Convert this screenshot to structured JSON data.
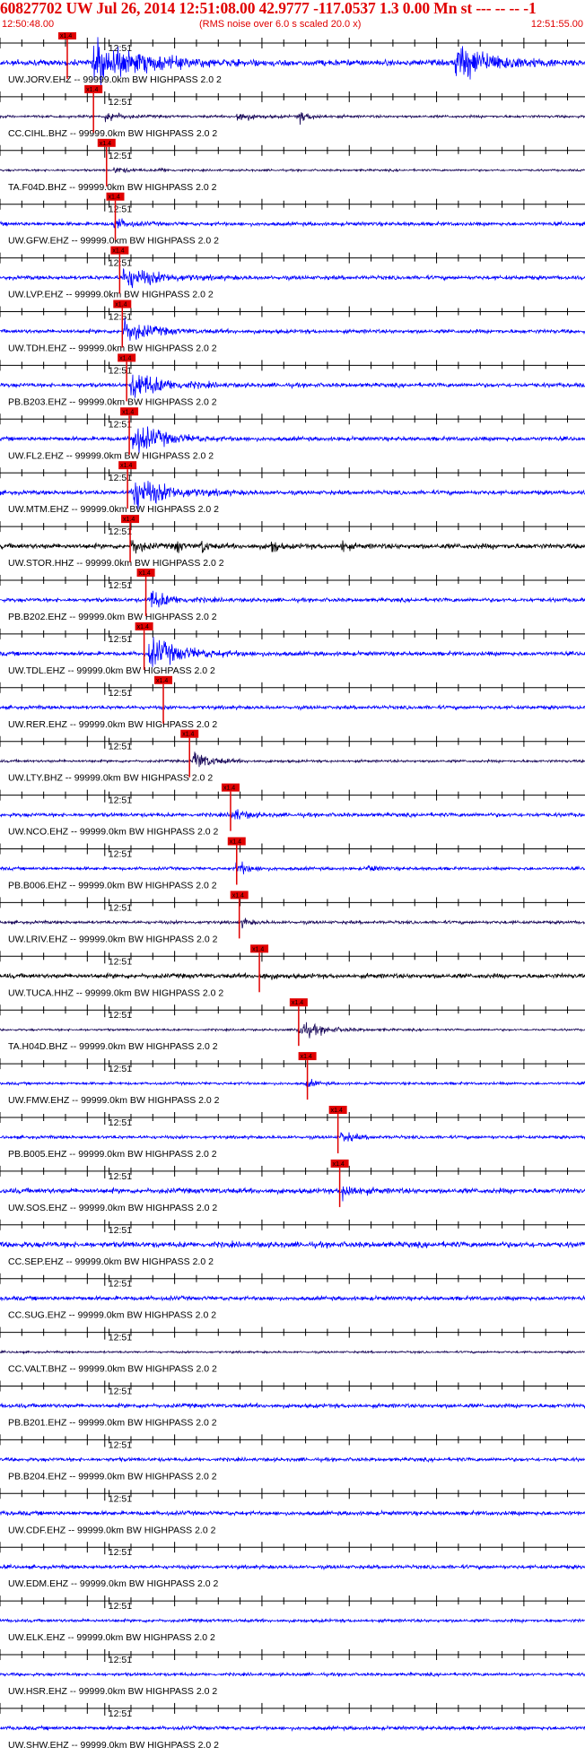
{
  "header": {
    "title": "60827702 UW Jul 26, 2014 12:51:08.00   42.9777 -117.0537  1.3 0.00 Mn st --- -- --  -1",
    "start_time": "12:50:48.00",
    "note": "(RMS noise over 6.0 s scaled 20.0 x)",
    "end_time": "12:51:55.00"
  },
  "colors": {
    "header_text": "#e00000",
    "trace_blue": "#0000ff",
    "trace_dark": "#1a0a5a",
    "trace_black": "#000000",
    "pick": "#e00000",
    "axis": "#000000"
  },
  "chart_data": {
    "type": "line",
    "x_unit": "time",
    "xlim": [
      "12:50:48.00",
      "12:51:55.00"
    ],
    "minute_label": "12:51",
    "pick_label": "x1.4",
    "label_suffix": " -- 99999.0km BW  HIGHPASS  2.0  2",
    "traces": [
      {
        "station": "UW.JORV.EHZ",
        "color": "blue",
        "pick": "12:50:55.5",
        "events": [
          {
            "t": "12:50:58.5",
            "amp": 1.6,
            "dur": 12
          },
          {
            "t": "12:51:40.0",
            "amp": 1.6,
            "dur": 9
          }
        ],
        "noise": 0.22
      },
      {
        "station": "CC.CIHL.BHZ",
        "color": "dark",
        "pick": "12:50:58.5",
        "events": [
          {
            "t": "12:51:00.0",
            "amp": 0.6,
            "dur": 3
          },
          {
            "t": "12:51:15.0",
            "amp": 0.55,
            "dur": 3
          },
          {
            "t": "12:51:22.0",
            "amp": 0.5,
            "dur": 3
          }
        ],
        "noise": 0.1
      },
      {
        "station": "TA.F04D.BHZ",
        "color": "dark",
        "pick": "12:51:00.0",
        "events": [
          {
            "t": "12:51:01.0",
            "amp": 0.3,
            "dur": 3
          },
          {
            "t": "12:51:06.0",
            "amp": 0.25,
            "dur": 2
          }
        ],
        "noise": 0.08
      },
      {
        "station": "UW.GFW.EHZ",
        "color": "blue",
        "pick": "12:51:01.0",
        "events": [
          {
            "t": "12:51:01.0",
            "amp": 0.55,
            "dur": 3
          }
        ],
        "noise": 0.14
      },
      {
        "station": "UW.LVP.EHZ",
        "color": "blue",
        "pick": "12:51:01.5",
        "events": [
          {
            "t": "12:51:02.0",
            "amp": 0.9,
            "dur": 8
          }
        ],
        "noise": 0.15
      },
      {
        "station": "UW.TDH.EHZ",
        "color": "blue",
        "pick": "12:51:01.8",
        "events": [
          {
            "t": "12:51:02.0",
            "amp": 1.0,
            "dur": 6
          }
        ],
        "noise": 0.15
      },
      {
        "station": "PB.B203.EHZ",
        "color": "blue",
        "pick": "12:51:02.3",
        "events": [
          {
            "t": "12:51:03.0",
            "amp": 1.2,
            "dur": 7
          }
        ],
        "noise": 0.16
      },
      {
        "station": "UW.FL2.EHZ",
        "color": "blue",
        "pick": "12:51:02.6",
        "events": [
          {
            "t": "12:51:03.0",
            "amp": 1.3,
            "dur": 7
          }
        ],
        "noise": 0.16
      },
      {
        "station": "UW.MTM.EHZ",
        "color": "blue",
        "pick": "12:51:02.4",
        "events": [
          {
            "t": "12:51:03.0",
            "amp": 1.4,
            "dur": 8
          }
        ],
        "noise": 0.16
      },
      {
        "station": "UW.STOR.HHZ",
        "color": "black",
        "pick": "12:51:02.7",
        "events": [
          {
            "t": "12:51:03.0",
            "amp": 0.9,
            "dur": 2
          },
          {
            "t": "12:51:08.0",
            "amp": 0.9,
            "dur": 1
          },
          {
            "t": "12:51:11.0",
            "amp": 1.0,
            "dur": 1
          },
          {
            "t": "12:51:19.0",
            "amp": 1.1,
            "dur": 1
          },
          {
            "t": "12:51:27.0",
            "amp": 0.9,
            "dur": 1
          }
        ],
        "noise": 0.2
      },
      {
        "station": "PB.B202.EHZ",
        "color": "blue",
        "pick": "12:51:04.5",
        "events": [
          {
            "t": "12:51:05.0",
            "amp": 0.8,
            "dur": 5
          }
        ],
        "noise": 0.15
      },
      {
        "station": "UW.TDL.EHZ",
        "color": "blue",
        "pick": "12:51:04.3",
        "events": [
          {
            "t": "12:51:05.0",
            "amp": 1.2,
            "dur": 8
          }
        ],
        "noise": 0.16
      },
      {
        "station": "UW.RER.EHZ",
        "color": "blue",
        "pick": "12:51:06.5",
        "events": [],
        "noise": 0.14
      },
      {
        "station": "UW.LTY.BHZ",
        "color": "dark",
        "pick": "12:51:09.5",
        "events": [
          {
            "t": "12:51:10.0",
            "amp": 0.9,
            "dur": 4
          }
        ],
        "noise": 0.1
      },
      {
        "station": "UW.NCO.EHZ",
        "color": "blue",
        "pick": "12:51:14.2",
        "events": [
          {
            "t": "12:51:14.5",
            "amp": 0.55,
            "dur": 3
          }
        ],
        "noise": 0.15
      },
      {
        "station": "PB.B006.EHZ",
        "color": "blue",
        "pick": "12:51:14.9",
        "events": [
          {
            "t": "12:51:15.0",
            "amp": 0.65,
            "dur": 3
          },
          {
            "t": "12:51:30.0",
            "amp": 0.35,
            "dur": 2
          }
        ],
        "noise": 0.12
      },
      {
        "station": "UW.LRIV.EHZ",
        "color": "dark",
        "pick": "12:51:15.2",
        "events": [
          {
            "t": "12:51:15.5",
            "amp": 0.4,
            "dur": 2
          }
        ],
        "noise": 0.12
      },
      {
        "station": "UW.TUCA.HHZ",
        "color": "black",
        "pick": "12:51:17.5",
        "events": [
          {
            "t": "12:51:18.0",
            "amp": 0.3,
            "dur": 2
          }
        ],
        "noise": 0.18
      },
      {
        "station": "TA.H04D.BHZ",
        "color": "dark",
        "pick": "12:51:22.0",
        "events": [
          {
            "t": "12:51:22.0",
            "amp": 0.7,
            "dur": 6
          }
        ],
        "noise": 0.08
      },
      {
        "station": "UW.FMW.EHZ",
        "color": "blue",
        "pick": "12:51:23.0",
        "events": [
          {
            "t": "12:51:23.0",
            "amp": 0.4,
            "dur": 2
          }
        ],
        "noise": 0.1
      },
      {
        "station": "PB.B005.EHZ",
        "color": "blue",
        "pick": "12:51:26.5",
        "events": [
          {
            "t": "12:51:27.0",
            "amp": 0.5,
            "dur": 3
          }
        ],
        "noise": 0.12
      },
      {
        "station": "UW.SOS.EHZ",
        "color": "blue",
        "pick": "12:51:26.7",
        "events": [
          {
            "t": "12:51:27.0",
            "amp": 0.75,
            "dur": 3
          }
        ],
        "noise": 0.2
      },
      {
        "station": "CC.SEP.EHZ",
        "color": "blue",
        "pick": null,
        "events": [],
        "noise": 0.22
      },
      {
        "station": "CC.SUG.EHZ",
        "color": "blue",
        "pick": null,
        "events": [],
        "noise": 0.16
      },
      {
        "station": "CC.VALT.BHZ",
        "color": "dark",
        "pick": null,
        "events": [],
        "noise": 0.08
      },
      {
        "station": "PB.B201.EHZ",
        "color": "blue",
        "pick": null,
        "events": [],
        "noise": 0.16
      },
      {
        "station": "PB.B204.EHZ",
        "color": "blue",
        "pick": null,
        "events": [],
        "noise": 0.14
      },
      {
        "station": "UW.CDF.EHZ",
        "color": "blue",
        "pick": null,
        "events": [],
        "noise": 0.16
      },
      {
        "station": "UW.EDM.EHZ",
        "color": "blue",
        "pick": null,
        "events": [],
        "noise": 0.14
      },
      {
        "station": "UW.ELK.EHZ",
        "color": "blue",
        "pick": null,
        "events": [],
        "noise": 0.12
      },
      {
        "station": "UW.HSR.EHZ",
        "color": "blue",
        "pick": null,
        "events": [],
        "noise": 0.12
      },
      {
        "station": "UW.SHW.EHZ",
        "color": "blue",
        "pick": null,
        "events": [],
        "noise": 0.14
      }
    ]
  }
}
